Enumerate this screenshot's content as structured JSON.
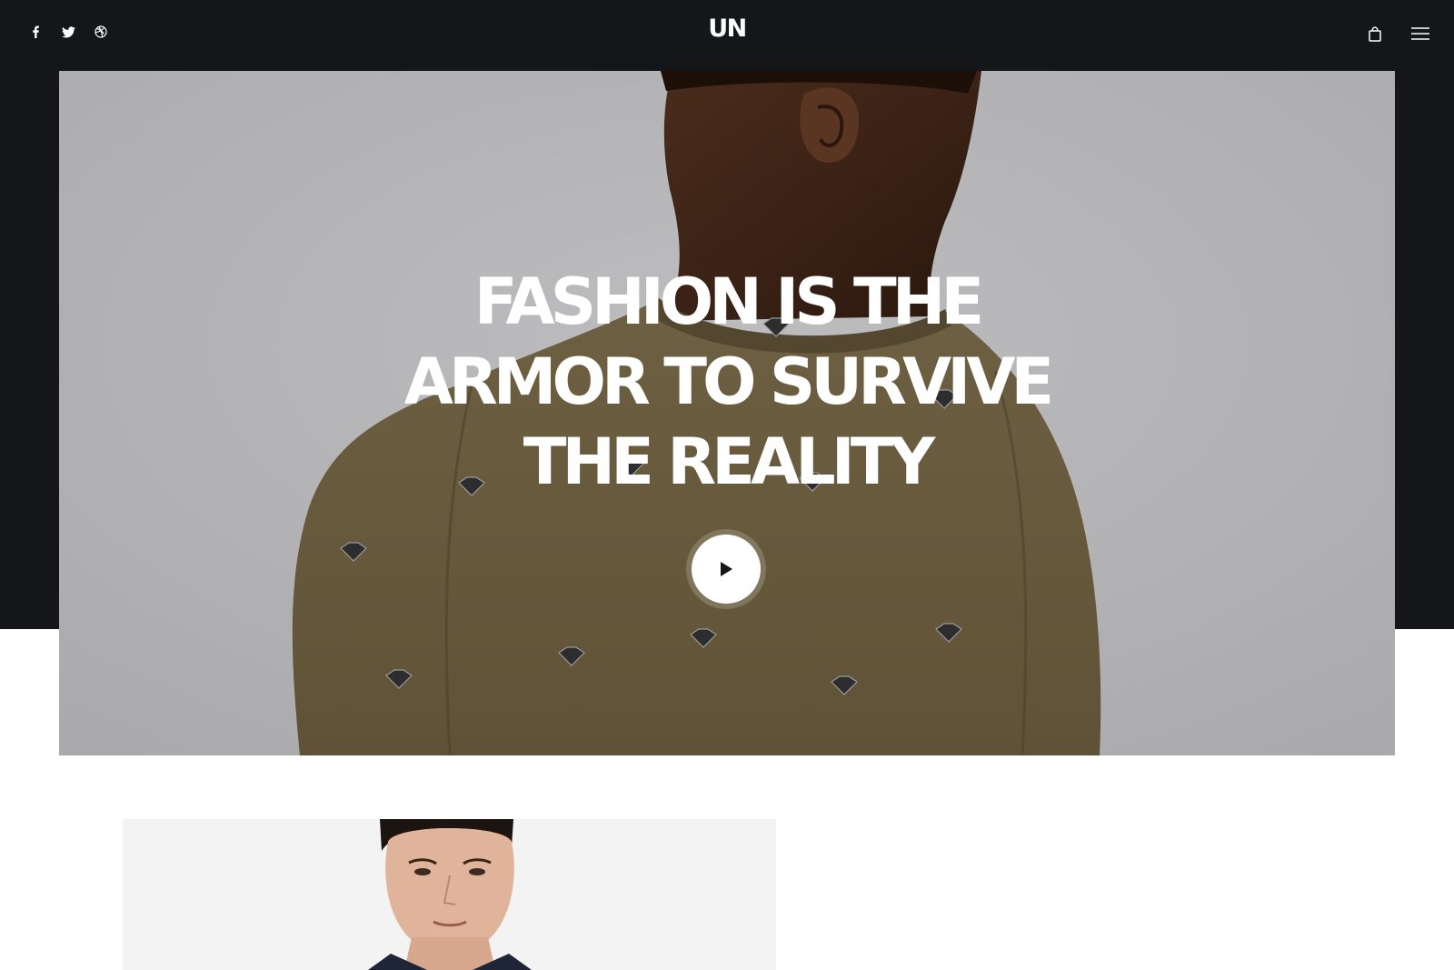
{
  "header": {
    "logo": "UN",
    "social_icons": [
      "facebook-icon",
      "twitter-icon",
      "dribbble-icon"
    ],
    "right_icons": [
      "shopping-bag-icon",
      "hamburger-menu-icon"
    ]
  },
  "hero": {
    "title_lines": [
      "FASHION IS THE",
      "ARMOR TO SURVIVE",
      "THE REALITY"
    ],
    "play_icon": "play-icon"
  },
  "colors": {
    "dark_band": "#151619",
    "hero_background": "#b3b3b5",
    "garment": "#6b5c3f",
    "text_on_dark": "#ffffff"
  }
}
